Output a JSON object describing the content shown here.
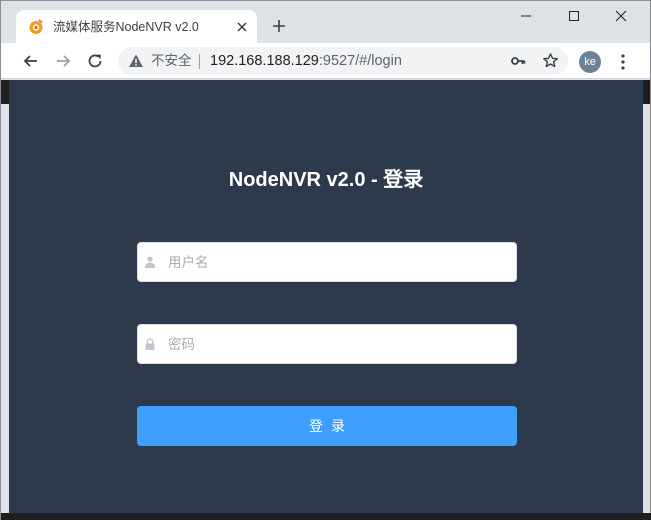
{
  "browser": {
    "tab": {
      "title": "流媒体服务NodeNVR v2.0",
      "favicon": "nodenvr-logo-icon"
    },
    "controls": {
      "minimize": "minimize-icon",
      "maximize": "maximize-icon",
      "close": "close-icon"
    },
    "address_bar": {
      "security_label": "不安全",
      "url_host": "192.168.188.129",
      "url_rest": ":9527/#/login"
    },
    "profile": {
      "initials": "ke"
    }
  },
  "login": {
    "title": "NodeNVR v2.0 - 登录",
    "username_placeholder": "用户名",
    "password_placeholder": "密码",
    "submit_label": "登录"
  },
  "colors": {
    "page_background": "#2d3a4b",
    "primary_button": "#409eff",
    "tab_bar": "#dee1e6"
  }
}
